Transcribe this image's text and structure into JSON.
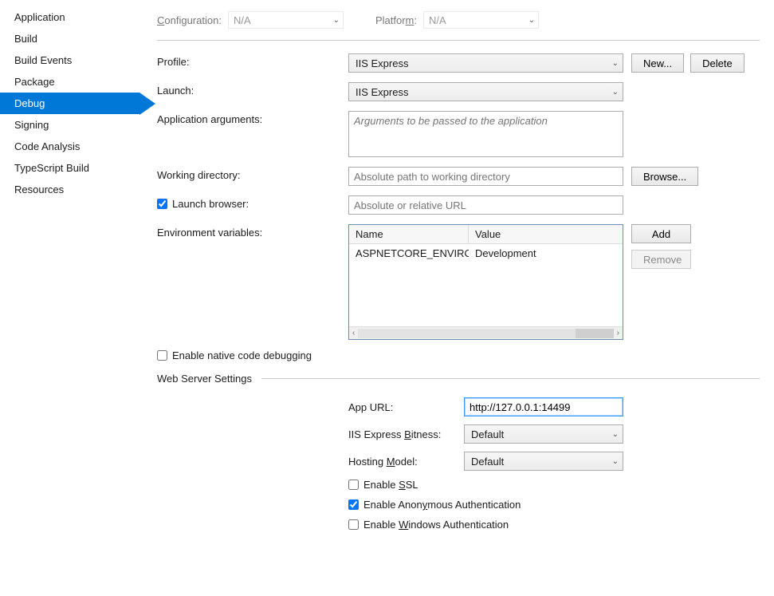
{
  "sidebar": {
    "items": [
      {
        "label": "Application"
      },
      {
        "label": "Build"
      },
      {
        "label": "Build Events"
      },
      {
        "label": "Package"
      },
      {
        "label": "Debug"
      },
      {
        "label": "Signing"
      },
      {
        "label": "Code Analysis"
      },
      {
        "label": "TypeScript Build"
      },
      {
        "label": "Resources"
      }
    ]
  },
  "top": {
    "config_label": "Configuration:",
    "config_value": "N/A",
    "platform_label": "Platform:",
    "platform_value": "N/A"
  },
  "fields": {
    "profile_label": "Profile:",
    "profile_value": "IIS Express",
    "new_btn": "New...",
    "delete_btn": "Delete",
    "launch_label": "Launch:",
    "launch_value": "IIS Express",
    "app_args_label": "Application arguments:",
    "app_args_placeholder": "Arguments to be passed to the application",
    "workdir_label": "Working directory:",
    "workdir_placeholder": "Absolute path to working directory",
    "browse_btn": "Browse...",
    "launch_browser_label": "Launch browser:",
    "launch_browser_placeholder": "Absolute or relative URL",
    "env_label": "Environment variables:",
    "env_name_header": "Name",
    "env_value_header": "Value",
    "env_rows": [
      {
        "name": "ASPNETCORE_ENVIRONMENT",
        "value": "Development"
      }
    ],
    "add_btn": "Add",
    "remove_btn": "Remove",
    "native_debug_label": "Enable native code debugging"
  },
  "web": {
    "section_title": "Web Server Settings",
    "app_url_label": "App URL:",
    "app_url_value": "http://127.0.0.1:14499",
    "bitness_label_pre": "IIS Express ",
    "bitness_label_key": "B",
    "bitness_label_post": "itness:",
    "bitness_value": "Default",
    "hosting_label_pre": "Hosting ",
    "hosting_label_key": "M",
    "hosting_label_post": "odel:",
    "hosting_value": "Default",
    "ssl_pre": "Enable ",
    "ssl_key": "S",
    "ssl_post": "SL",
    "anon_pre": "Enable Anon",
    "anon_key": "y",
    "anon_post": "mous Authentication",
    "win_pre": "Enable ",
    "win_key": "W",
    "win_post": "indows Authentication"
  }
}
